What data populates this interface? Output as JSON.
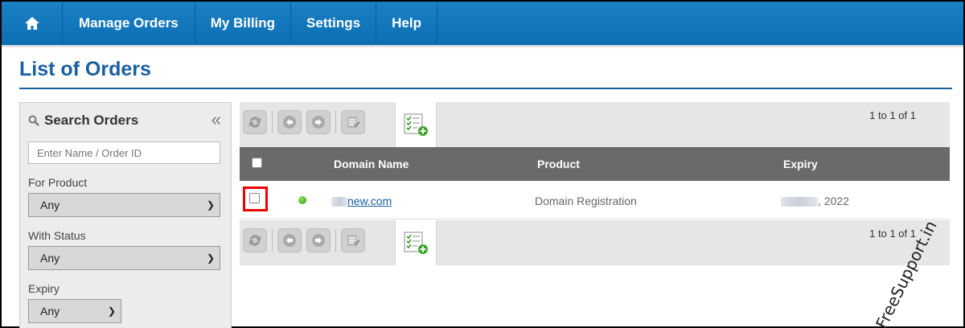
{
  "nav": {
    "items": [
      "Manage Orders",
      "My Billing",
      "Settings",
      "Help"
    ],
    "home_icon": "home-icon"
  },
  "page": {
    "title": "List of Orders"
  },
  "sidebar": {
    "title": "Search Orders",
    "collapse_glyph": "«",
    "search_placeholder": "Enter Name / Order ID",
    "for_product_label": "For Product",
    "for_product_value": "Any",
    "with_status_label": "With Status",
    "with_status_value": "Any",
    "expiry_label": "Expiry",
    "expiry_value": "Any"
  },
  "toolbar": {
    "pager": "1 to 1 of 1",
    "buttons": [
      "refresh-icon",
      "suspend-icon",
      "unsuspend-icon",
      "bulk-edit-icon"
    ],
    "add_icon": "add-order-icon"
  },
  "table": {
    "columns": [
      "Domain Name",
      "Product",
      "Expiry"
    ],
    "rows": [
      {
        "domain": "new.com",
        "product": "Domain Registration",
        "expiry": ", 2022",
        "status_color": "#3cb21a"
      }
    ]
  },
  "watermark": "FreeSupport.in",
  "colors": {
    "nav": "#1474b8",
    "title": "#1a5fa0",
    "header": "#6a6a6a",
    "highlight": "#e00000"
  }
}
